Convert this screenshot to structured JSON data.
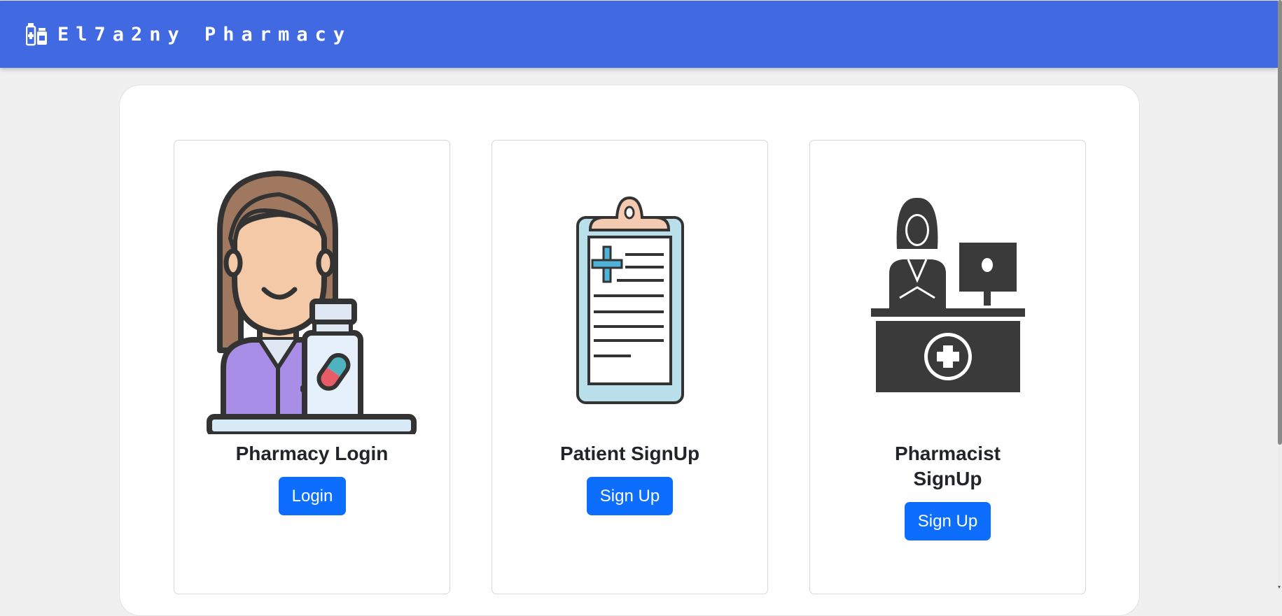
{
  "navbar": {
    "brand_icon": "pharmacy-bottles-icon",
    "brand_name": "El7a2ny Pharmacy",
    "background_color": "#4169e1"
  },
  "cards": [
    {
      "illustration": "pharmacist-woman-illustration",
      "title": "Pharmacy Login",
      "button_label": "Login"
    },
    {
      "illustration": "medical-clipboard-illustration",
      "title": "Patient SignUp",
      "button_label": "Sign Up"
    },
    {
      "illustration": "pharmacist-desk-illustration",
      "title_line1": "Pharmacist",
      "title_line2": "SignUp",
      "button_label": "Sign Up"
    }
  ],
  "colors": {
    "button": "#0d6efd",
    "page_background": "#f0f0f0"
  }
}
